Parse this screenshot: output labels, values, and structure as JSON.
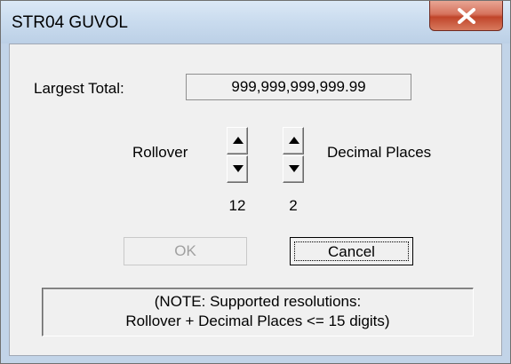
{
  "window": {
    "title": "STR04 GUVOL"
  },
  "form": {
    "largest_total_label": "Largest Total:",
    "largest_total_value": "999,999,999,999.99",
    "rollover_label": "Rollover",
    "rollover_value": "12",
    "decimal_places_label": "Decimal Places",
    "decimal_places_value": "2"
  },
  "buttons": {
    "ok_label": "OK",
    "ok_enabled": false,
    "cancel_label": "Cancel"
  },
  "note": {
    "line1": "(NOTE: Supported resolutions:",
    "line2": "Rollover + Decimal Places <= 15 digits)"
  },
  "icons": {
    "close": "close-icon",
    "spin_up": "triangle-up-icon",
    "spin_down": "triangle-down-icon"
  },
  "colors": {
    "close_button": "#c7462c",
    "dialog_face": "#f0f0f0",
    "frame": "#c2d4e8"
  }
}
